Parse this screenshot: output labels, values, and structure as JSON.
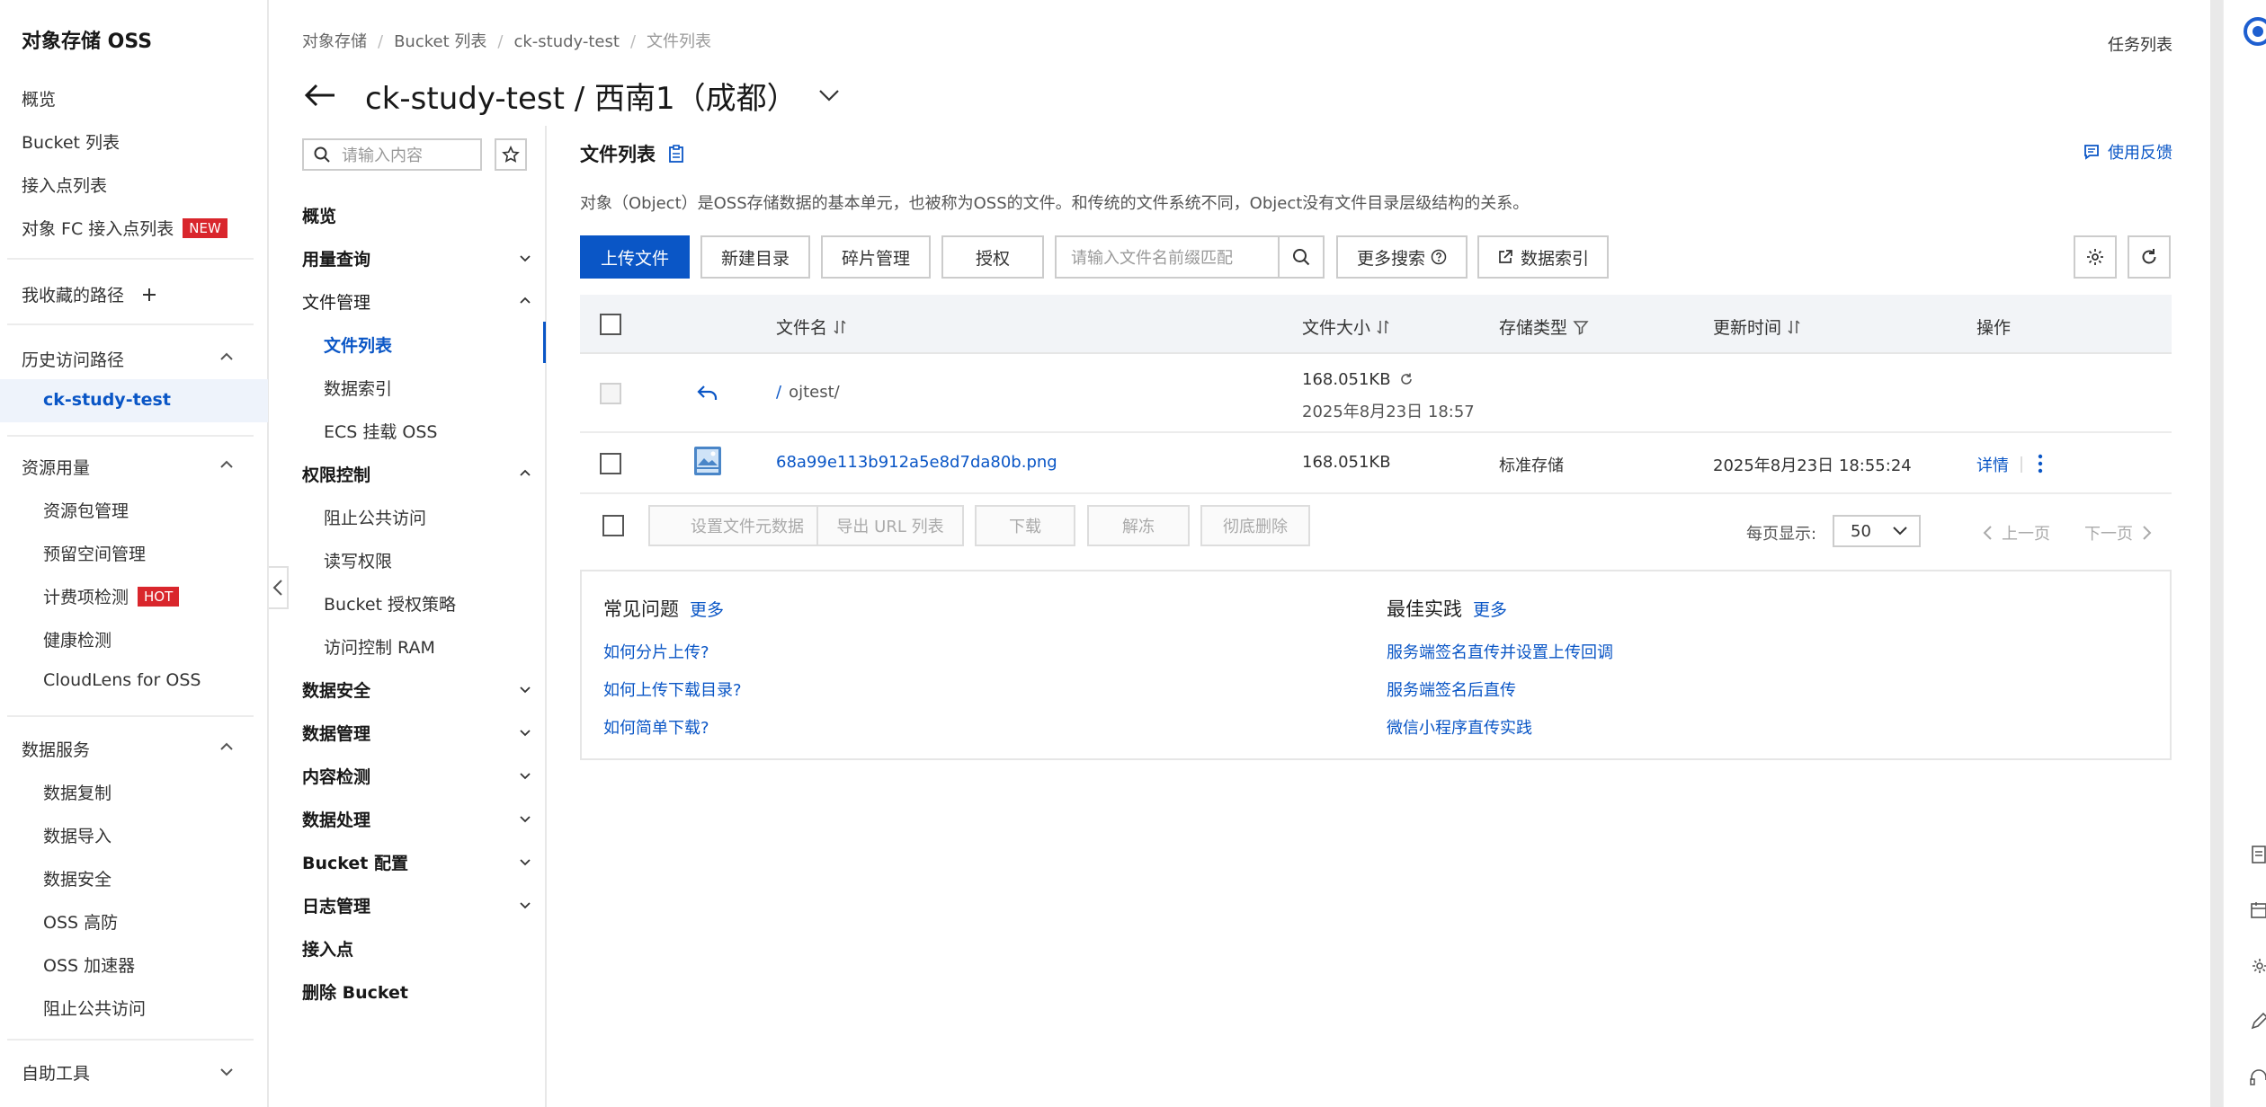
{
  "sidebar": {
    "brand": "对象存储 OSS",
    "items": {
      "overview": "概览",
      "bucket_list": "Bucket 列表",
      "access_points": "接入点列表",
      "fc_access": "对象 FC 接入点列表",
      "fc_tag": "NEW",
      "favorites": "我收藏的路径",
      "history": "历史访问路径",
      "history_item": "ck-study-test",
      "resources": "资源用量",
      "res_pkg": "资源包管理",
      "res_reserved": "预留空间管理",
      "res_billing": "计费项检测",
      "res_billing_tag": "HOT",
      "res_health": "健康检测",
      "res_cloudlens": "CloudLens for OSS",
      "data_services": "数据服务",
      "ds_replication": "数据复制",
      "ds_import": "数据导入",
      "ds_security": "数据安全",
      "ds_oss_defense": "OSS 高防",
      "ds_accelerator": "OSS 加速器",
      "ds_block_public": "阻止公共访问",
      "self_tools": "自助工具"
    }
  },
  "header": {
    "breadcrumb": [
      "对象存储",
      "Bucket 列表",
      "ck-study-test",
      "文件列表"
    ],
    "task_list": "任务列表",
    "title": "ck-study-test / 西南1（成都）"
  },
  "nav2": {
    "search_placeholder": "请输入内容",
    "overview": "概览",
    "usage": "用量查询",
    "file_mgmt": "文件管理",
    "file_list": "文件列表",
    "data_index": "数据索引",
    "ecs_mount": "ECS 挂载 OSS",
    "permission": "权限控制",
    "block_public": "阻止公共访问",
    "rw_perm": "读写权限",
    "bucket_policy": "Bucket 授权策略",
    "ram": "访问控制 RAM",
    "data_security": "数据安全",
    "data_mgmt": "数据管理",
    "content_check": "内容检测",
    "data_processing": "数据处理",
    "bucket_config": "Bucket 配置",
    "log_mgmt": "日志管理",
    "access_point": "接入点",
    "delete_bucket": "删除 Bucket"
  },
  "main": {
    "title": "文件列表",
    "feedback": "使用反馈",
    "description": "对象（Object）是OSS存储数据的基本单元，也被称为OSS的文件。和传统的文件系统不同，Object没有文件目录层级结构的关系。",
    "toolbar": {
      "upload": "上传文件",
      "new_dir": "新建目录",
      "fragments": "碎片管理",
      "authorize": "授权",
      "search_placeholder": "请输入文件名前缀匹配",
      "more_search": "更多搜索",
      "data_index": "数据索引"
    },
    "table": {
      "headers": {
        "name": "文件名",
        "size": "文件大小",
        "storage": "存储类型",
        "updated": "更新时间",
        "actions": "操作"
      },
      "parent_row": {
        "path": "ojtest/",
        "size": "168.051KB",
        "date": "2025年8月23日 18:57"
      },
      "rows": [
        {
          "name": "68a99e113b912a5e8d7da80b.png",
          "size": "168.051KB",
          "storage": "标准存储",
          "updated": "2025年8月23日 18:55:24",
          "detail": "详情"
        }
      ]
    },
    "bulk": {
      "set_meta": "设置文件元数据",
      "export_url": "导出 URL 列表",
      "download": "下载",
      "unfreeze": "解冻",
      "delete": "彻底删除"
    },
    "pager": {
      "per_page_label": "每页显示:",
      "per_page": "50",
      "prev": "上一页",
      "next": "下一页"
    },
    "faq": {
      "title": "常见问题",
      "more": "更多",
      "items": [
        "如何分片上传?",
        "如何上传下载目录?",
        "如何简单下载?"
      ]
    },
    "best": {
      "title": "最佳实践",
      "more": "更多",
      "items": [
        "服务端签名直传并设置上传回调",
        "服务端签名后直传",
        "微信小程序直传实践"
      ]
    }
  },
  "colors": {
    "accent": "#0a56c6",
    "tag": "#d9262c"
  }
}
